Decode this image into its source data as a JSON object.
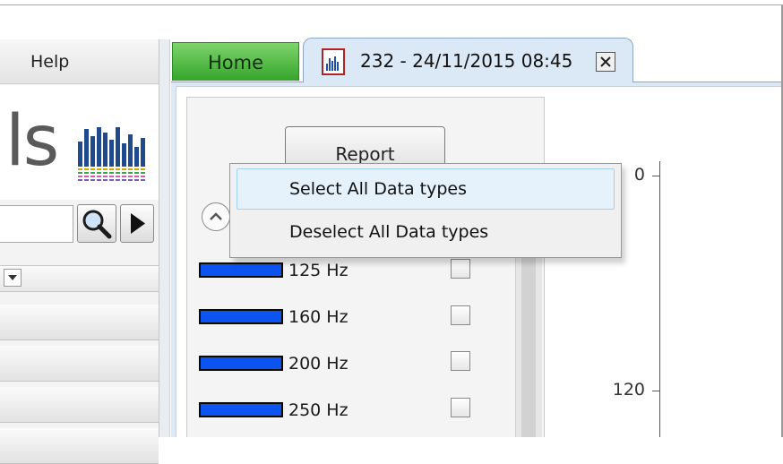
{
  "menu": {
    "help": "Help"
  },
  "logo": {
    "text": "ls"
  },
  "tabs": [
    {
      "label": "Home",
      "color": "#3dac32"
    },
    {
      "label": "232 - 24/11/2015 08:45",
      "icon": "report-document-icon"
    }
  ],
  "side_panel": {
    "report_button": "Report",
    "frequencies": [
      {
        "label": "125 Hz",
        "checked": false
      },
      {
        "label": "160 Hz",
        "checked": false
      },
      {
        "label": "200 Hz",
        "checked": false
      },
      {
        "label": "250 Hz",
        "checked": false
      }
    ]
  },
  "chart_axis": {
    "ticks": [
      "0",
      "120"
    ]
  },
  "context_menu": {
    "items": [
      {
        "label": "Select All Data types",
        "highlighted": true
      },
      {
        "label": "Deselect All Data types",
        "highlighted": false
      }
    ]
  },
  "colors": {
    "accent_blue": "#0b54f0",
    "home_green": "#3dac32",
    "hover": "#e5f1fb"
  }
}
